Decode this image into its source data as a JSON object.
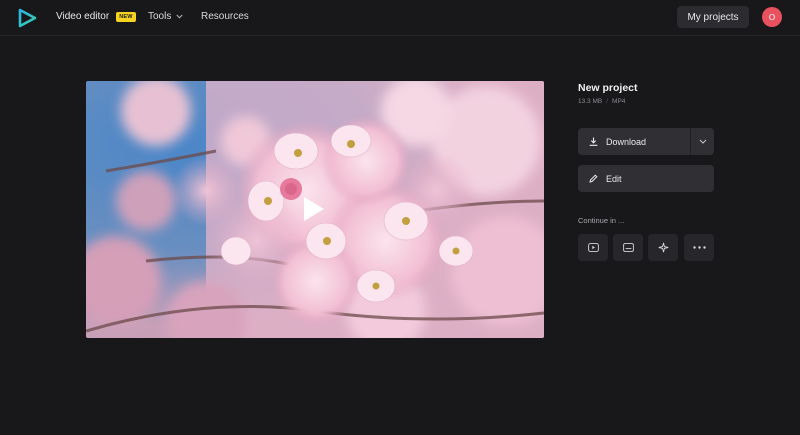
{
  "header": {
    "nav_video_editor": "Video editor",
    "badge_new": "NEW",
    "nav_tools": "Tools",
    "nav_resources": "Resources",
    "my_projects": "My projects",
    "avatar_initial": "O"
  },
  "project": {
    "title": "New project",
    "size": "13.3 MB",
    "format": "MP4"
  },
  "actions": {
    "download": "Download",
    "edit": "Edit",
    "continue_in": "Continue in ..."
  },
  "continue_buttons": [
    "youtube-icon",
    "subtitles-icon",
    "sparkle-icon",
    "more-icon"
  ],
  "colors": {
    "background": "#18181b",
    "panel_button": "#2f2f34",
    "badge": "#f5d320",
    "avatar": "#e8525e",
    "logo_start": "#2ab3e6",
    "logo_end": "#3bd0a8"
  }
}
